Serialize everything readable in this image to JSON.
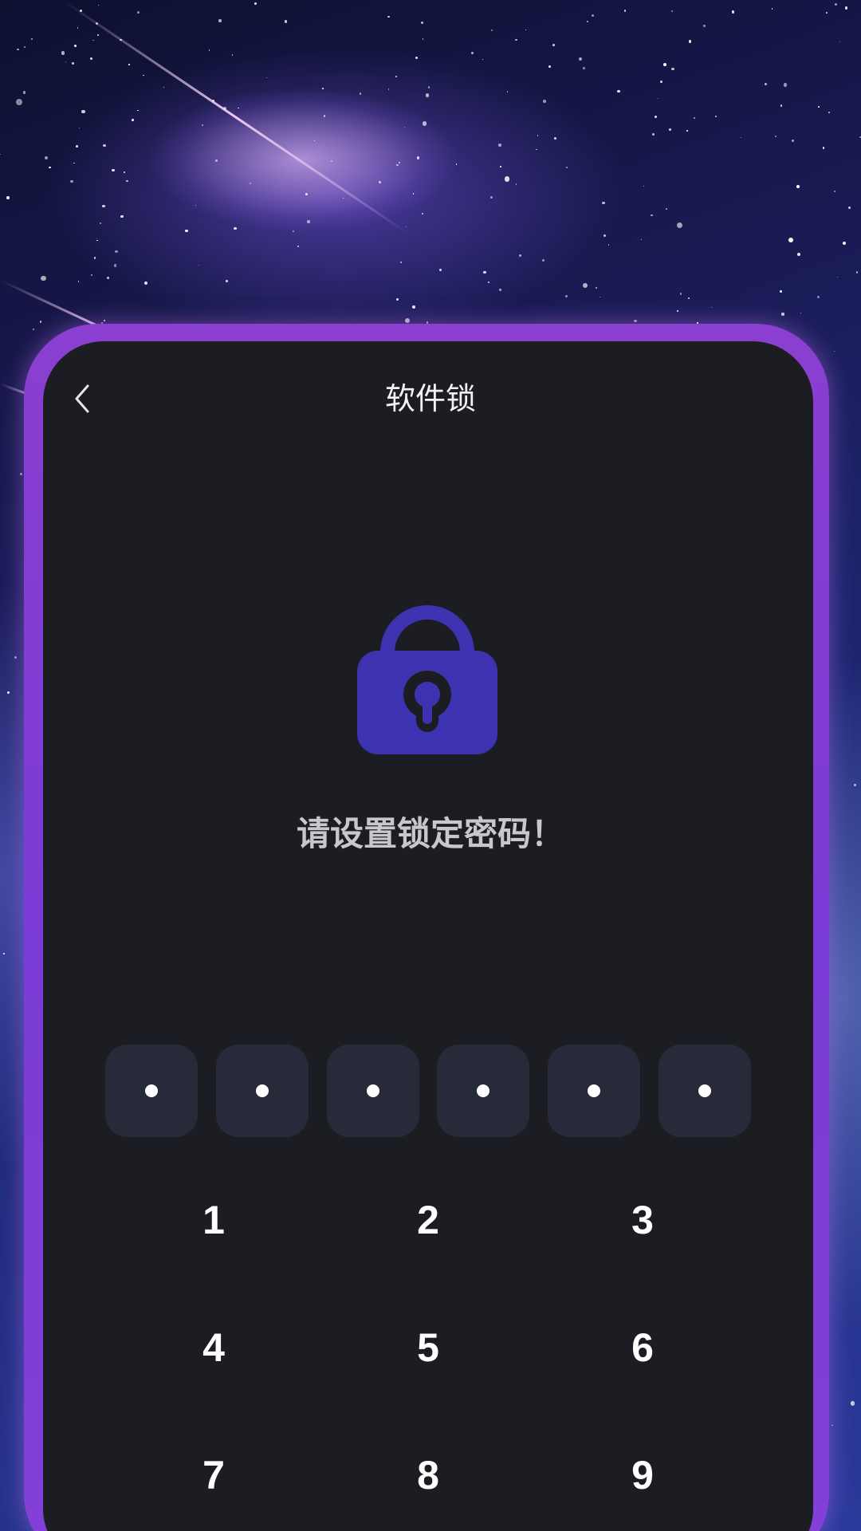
{
  "header": {
    "title": "软件锁",
    "back_icon": "chevron-left-icon"
  },
  "lock": {
    "icon": "padlock-icon",
    "color": "#3d33b0"
  },
  "prompt": {
    "text": "请设置锁定密码！"
  },
  "pin": {
    "length": 6,
    "filled": 6
  },
  "keypad": {
    "keys": [
      "1",
      "2",
      "3",
      "4",
      "5",
      "6",
      "7",
      "8",
      "9"
    ]
  },
  "colors": {
    "panel_bg": "#1b1d22",
    "frame": "#8a3fd0",
    "pin_box": "#272a38",
    "accent": "#3d33b0"
  }
}
